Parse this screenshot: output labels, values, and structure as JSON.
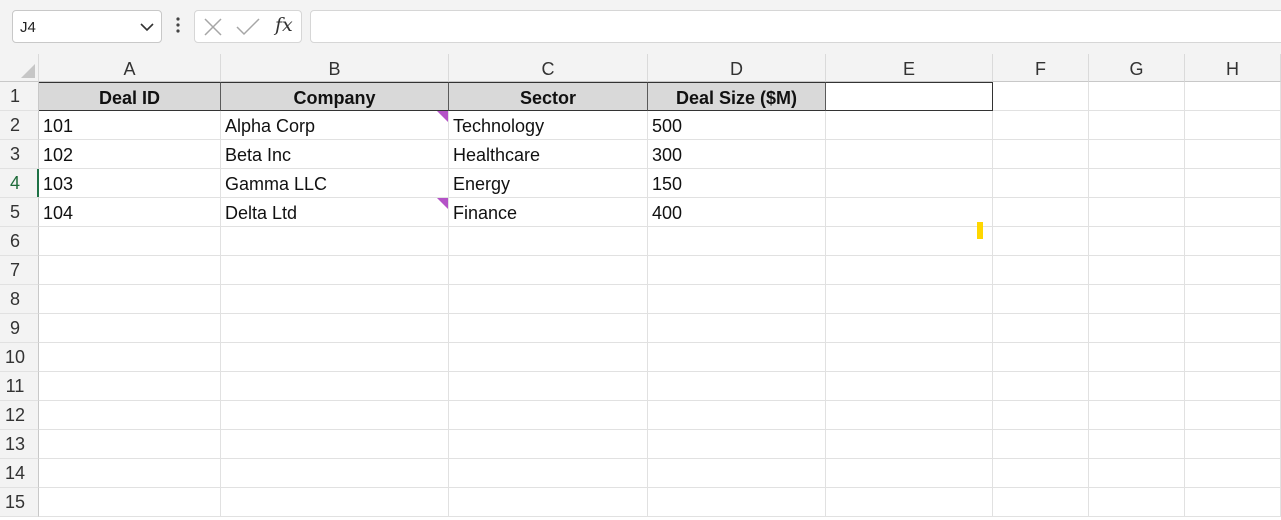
{
  "formula_bar": {
    "name_box": "J4",
    "fx_label": "fx",
    "formula": ""
  },
  "columns": [
    "A",
    "B",
    "C",
    "D",
    "E",
    "F",
    "G",
    "H"
  ],
  "rows": [
    "1",
    "2",
    "3",
    "4",
    "5",
    "6",
    "7",
    "8",
    "9",
    "10",
    "11",
    "12",
    "13",
    "14",
    "15"
  ],
  "active_row": "4",
  "table": {
    "headers": [
      "Deal ID",
      "Company",
      "Sector",
      "Deal Size ($M)"
    ],
    "rows": [
      [
        "101",
        "Alpha Corp",
        "Technology",
        "500"
      ],
      [
        "102",
        "Beta Inc",
        "Healthcare",
        "300"
      ],
      [
        "103",
        "Gamma LLC",
        "Energy",
        "150"
      ],
      [
        "104",
        "Delta Ltd",
        "Finance",
        "400"
      ]
    ]
  },
  "comment_indicator_color": "#b452c7",
  "selection_color": "#1e7145"
}
